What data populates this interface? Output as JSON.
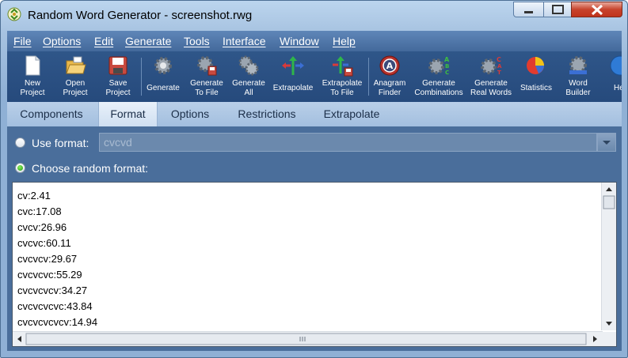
{
  "window": {
    "title": "Random Word Generator - screenshot.rwg",
    "app_icon": "recycle-gear-icon"
  },
  "window_controls": {
    "minimize_icon": "minimize-icon",
    "maximize_icon": "maximize-icon",
    "close_icon": "close-icon"
  },
  "menu": {
    "items": [
      "File",
      "Options",
      "Edit",
      "Generate",
      "Tools",
      "Interface",
      "Window",
      "Help"
    ]
  },
  "toolbar": {
    "buttons": [
      {
        "line1": "New",
        "line2": "Project",
        "icon": "new-document-icon"
      },
      {
        "line1": "Open",
        "line2": "Project",
        "icon": "open-folder-icon"
      },
      {
        "line1": "Save",
        "line2": "Project",
        "icon": "save-floppy-icon"
      },
      {
        "line1": "Generate",
        "line2": "",
        "icon": "gear-icon"
      },
      {
        "line1": "Generate",
        "line2": "To File",
        "icon": "gear-file-icon"
      },
      {
        "line1": "Generate",
        "line2": "All",
        "icon": "gears-icon"
      },
      {
        "line1": "Extrapolate",
        "line2": "",
        "icon": "extrapolate-arrows-icon"
      },
      {
        "line1": "Extrapolate",
        "line2": "To File",
        "icon": "extrapolate-file-icon"
      },
      {
        "line1": "Anagram",
        "line2": "Finder",
        "icon": "anagram-badge-icon"
      },
      {
        "line1": "Generate",
        "line2": "Combinations",
        "icon": "gear-abc-icon"
      },
      {
        "line1": "Generate",
        "line2": "Real Words",
        "icon": "gear-cat-icon"
      },
      {
        "line1": "Statistics",
        "line2": "",
        "icon": "pie-chart-icon"
      },
      {
        "line1": "Word",
        "line2": "Builder",
        "icon": "word-builder-icon"
      },
      {
        "line1": "He",
        "line2": "",
        "icon": "help-icon"
      }
    ]
  },
  "tabs": [
    "Components",
    "Format",
    "Options",
    "Restrictions",
    "Extrapolate"
  ],
  "active_tab": "Format",
  "format": {
    "use_format_label": "Use format:",
    "use_format_value": "cvcvd",
    "use_format_selected": false,
    "choose_random_label": "Choose random format:",
    "choose_random_selected": true,
    "lines": [
      "cv:2.41",
      "cvc:17.08",
      "cvcv:26.96",
      "cvcvc:60.11",
      "cvcvcv:29.67",
      "cvcvcvc:55.29",
      "cvcvcvcv:34.27",
      "cvcvcvcvc:43.84",
      "cvcvcvcvcv:14.94"
    ]
  },
  "colors": {
    "menubar": "#4f76a9",
    "toolbar": "#2b5185",
    "panel": "#4a6e9b",
    "close_button": "#c7432c"
  }
}
